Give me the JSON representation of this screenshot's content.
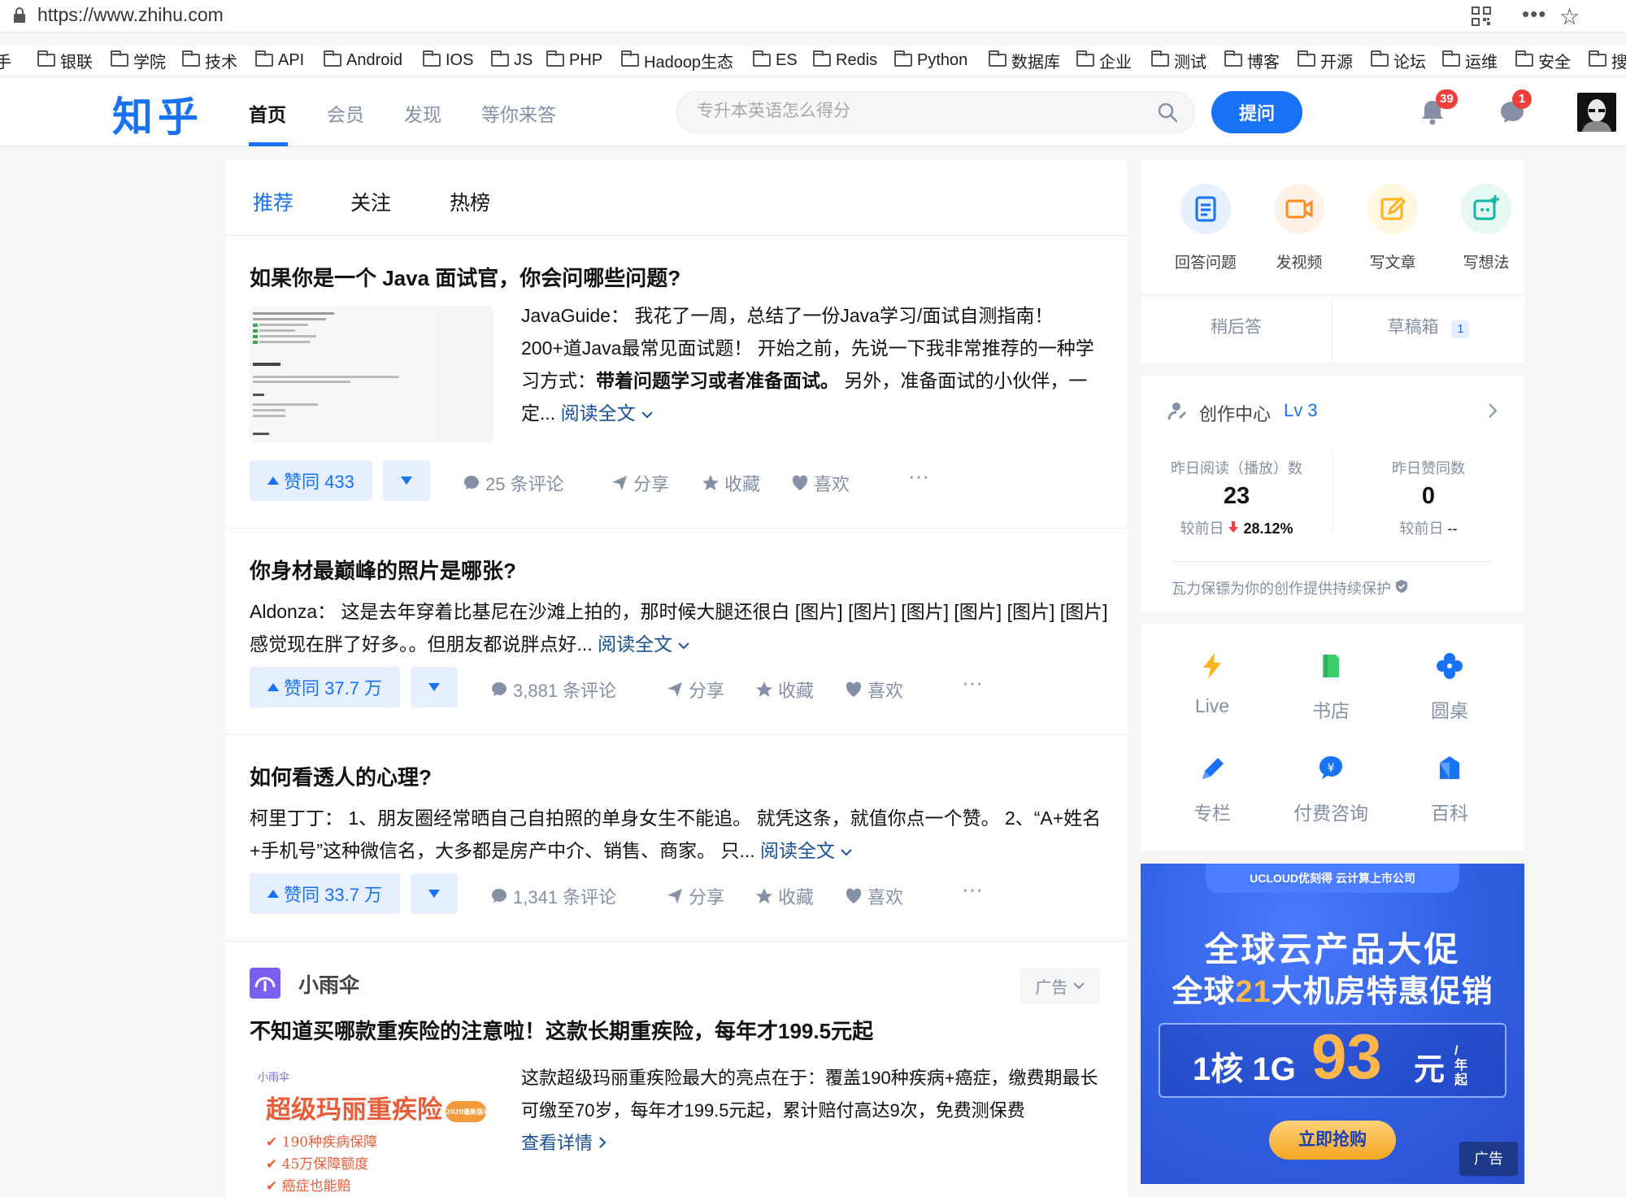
{
  "browser": {
    "url": "https://www.zhihu.com",
    "bookmarks": [
      "手",
      "银联",
      "学院",
      "技术",
      "API",
      "Android",
      "IOS",
      "JS",
      "PHP",
      "Hadoop生态",
      "ES",
      "Redis",
      "Python",
      "数据库",
      "企业",
      "测试",
      "博客",
      "开源",
      "论坛",
      "运维",
      "安全",
      "搜"
    ]
  },
  "header": {
    "logo": "知乎",
    "nav": [
      "首页",
      "会员",
      "发现",
      "等你来答"
    ],
    "search_placeholder": "专升本英语怎么得分",
    "ask_label": "提问",
    "notifications_count": "39",
    "messages_count": "1"
  },
  "feed": {
    "tabs": [
      "推荐",
      "关注",
      "热榜"
    ],
    "items": [
      {
        "title": "如果你是一个 Java 面试官，你会问哪些问题?",
        "excerpt_a": "JavaGuide： 我花了一周，总结了一份Java学习/面试自测指南！200+道Java最常见面试题！ 开始之前，先说一下我非常推荐的一种学习方式：",
        "excerpt_strong": "带着问题学习或者准备面试。",
        "excerpt_b": " 另外，准备面试的小伙伴，一定...",
        "readmore": "阅读全文",
        "vote": "赞同 433",
        "comments": "25 条评论"
      },
      {
        "title": "你身材最巅峰的照片是哪张?",
        "excerpt": "Aldonza： 这是去年穿着比基尼在沙滩上拍的，那时候大腿还很白 [图片] [图片] [图片] [图片] [图片] [图片] 感觉现在胖了好多。。但朋友都说胖点好...",
        "readmore": "阅读全文",
        "vote": "赞同 37.7 万",
        "comments": "3,881 条评论"
      },
      {
        "title": "如何看透人的心理?",
        "excerpt": "柯里丁丁： 1、朋友圈经常晒自己自拍照的单身女生不能追。 就凭这条，就值你点一个赞。 2、“A+姓名+手机号”这种微信名，大多都是房产中介、销售、商家。 只...",
        "readmore": "阅读全文",
        "vote": "赞同 33.7 万",
        "comments": "1,341 条评论"
      }
    ],
    "actions": {
      "share": "分享",
      "collect": "收藏",
      "like": "喜欢"
    },
    "ad": {
      "brand": "小雨伞",
      "tag": "广告",
      "title": "不知道买哪款重疾险的注意啦！这款长期重疾险，每年才199.5元起",
      "excerpt": "这款超级玛丽重疾险最大的亮点在于：覆盖190种疾病+癌症，缴费期最长可缴至70岁，每年才199.5元起，累计赔付高达9次，免费测保费",
      "readmore": "查看详情",
      "img_brand": "小雨伞",
      "img_title": "超级玛丽重疾险",
      "img_badge": "2020最新版本",
      "img_lines": [
        "190种疾病保障",
        "45万保障额度",
        "癌症也能赔"
      ]
    }
  },
  "sidebar": {
    "quick": [
      "回答问题",
      "发视频",
      "写文章",
      "写想法"
    ],
    "later": "稍后答",
    "drafts": "草稿箱",
    "drafts_count": "1",
    "creator": {
      "title": "创作中心",
      "level": "Lv 3",
      "read_label": "昨日阅读（播放）数",
      "read_value": "23",
      "read_cmp_label": "较前日",
      "read_cmp_value": "28.12%",
      "agree_label": "昨日赞同数",
      "agree_value": "0",
      "agree_cmp_label": "较前日",
      "agree_cmp_value": "--",
      "protect": "瓦力保镖为你的创作提供持续保护"
    },
    "tools": [
      "Live",
      "书店",
      "圆桌",
      "专栏",
      "付费咨询",
      "百科"
    ],
    "banner": {
      "top": "UCLOUD优刻得 云计算上市公司",
      "line1": "全球云产品大促",
      "line2a": "全球",
      "line2b": "21",
      "line2c": "大机房特惠促销",
      "spec": "1核 1G",
      "price": "93",
      "unit": "元",
      "per": "/年起",
      "cta": "立即抢购",
      "tag": "广告"
    }
  }
}
